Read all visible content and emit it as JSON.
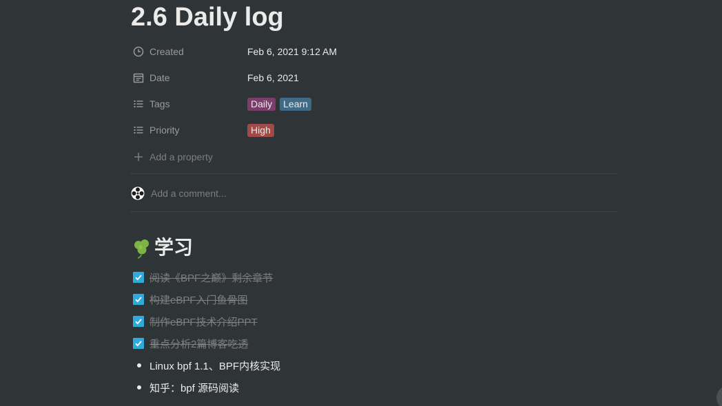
{
  "page": {
    "title": "2.6 Daily log"
  },
  "properties": {
    "created": {
      "label": "Created",
      "value": "Feb 6, 2021 9:12 AM",
      "icon": "clock-icon"
    },
    "date": {
      "label": "Date",
      "value": "Feb 6, 2021",
      "icon": "calendar-icon"
    },
    "tags": {
      "label": "Tags",
      "icon": "list-icon",
      "items": [
        {
          "label": "Daily",
          "color": "#7b3d6a"
        },
        {
          "label": "Learn",
          "color": "#3f6b87"
        }
      ]
    },
    "priority": {
      "label": "Priority",
      "icon": "list-icon",
      "items": [
        {
          "label": "High",
          "color": "#a14a48"
        }
      ]
    },
    "add_property_label": "Add a property"
  },
  "comment": {
    "placeholder": "Add a comment..."
  },
  "section": {
    "icon": "shamrock-icon",
    "heading": "学习"
  },
  "todos": [
    {
      "text": "阅读《BPF之巅》剩余章节",
      "checked": true
    },
    {
      "text": "构建eBPF入门鱼骨图",
      "checked": true
    },
    {
      "text": "制作eBPF技术介绍PPT",
      "checked": true
    },
    {
      "text": "重点分析2篇博客吃透",
      "checked": true
    }
  ],
  "bullets": [
    {
      "text": "Linux bpf 1.1、BPF内核实现"
    },
    {
      "text": "知乎：bpf 源码阅读"
    }
  ],
  "colors": {
    "background": "#2f3437",
    "checkbox": "#2eaadc",
    "muted_text": "#9b9b9b"
  }
}
